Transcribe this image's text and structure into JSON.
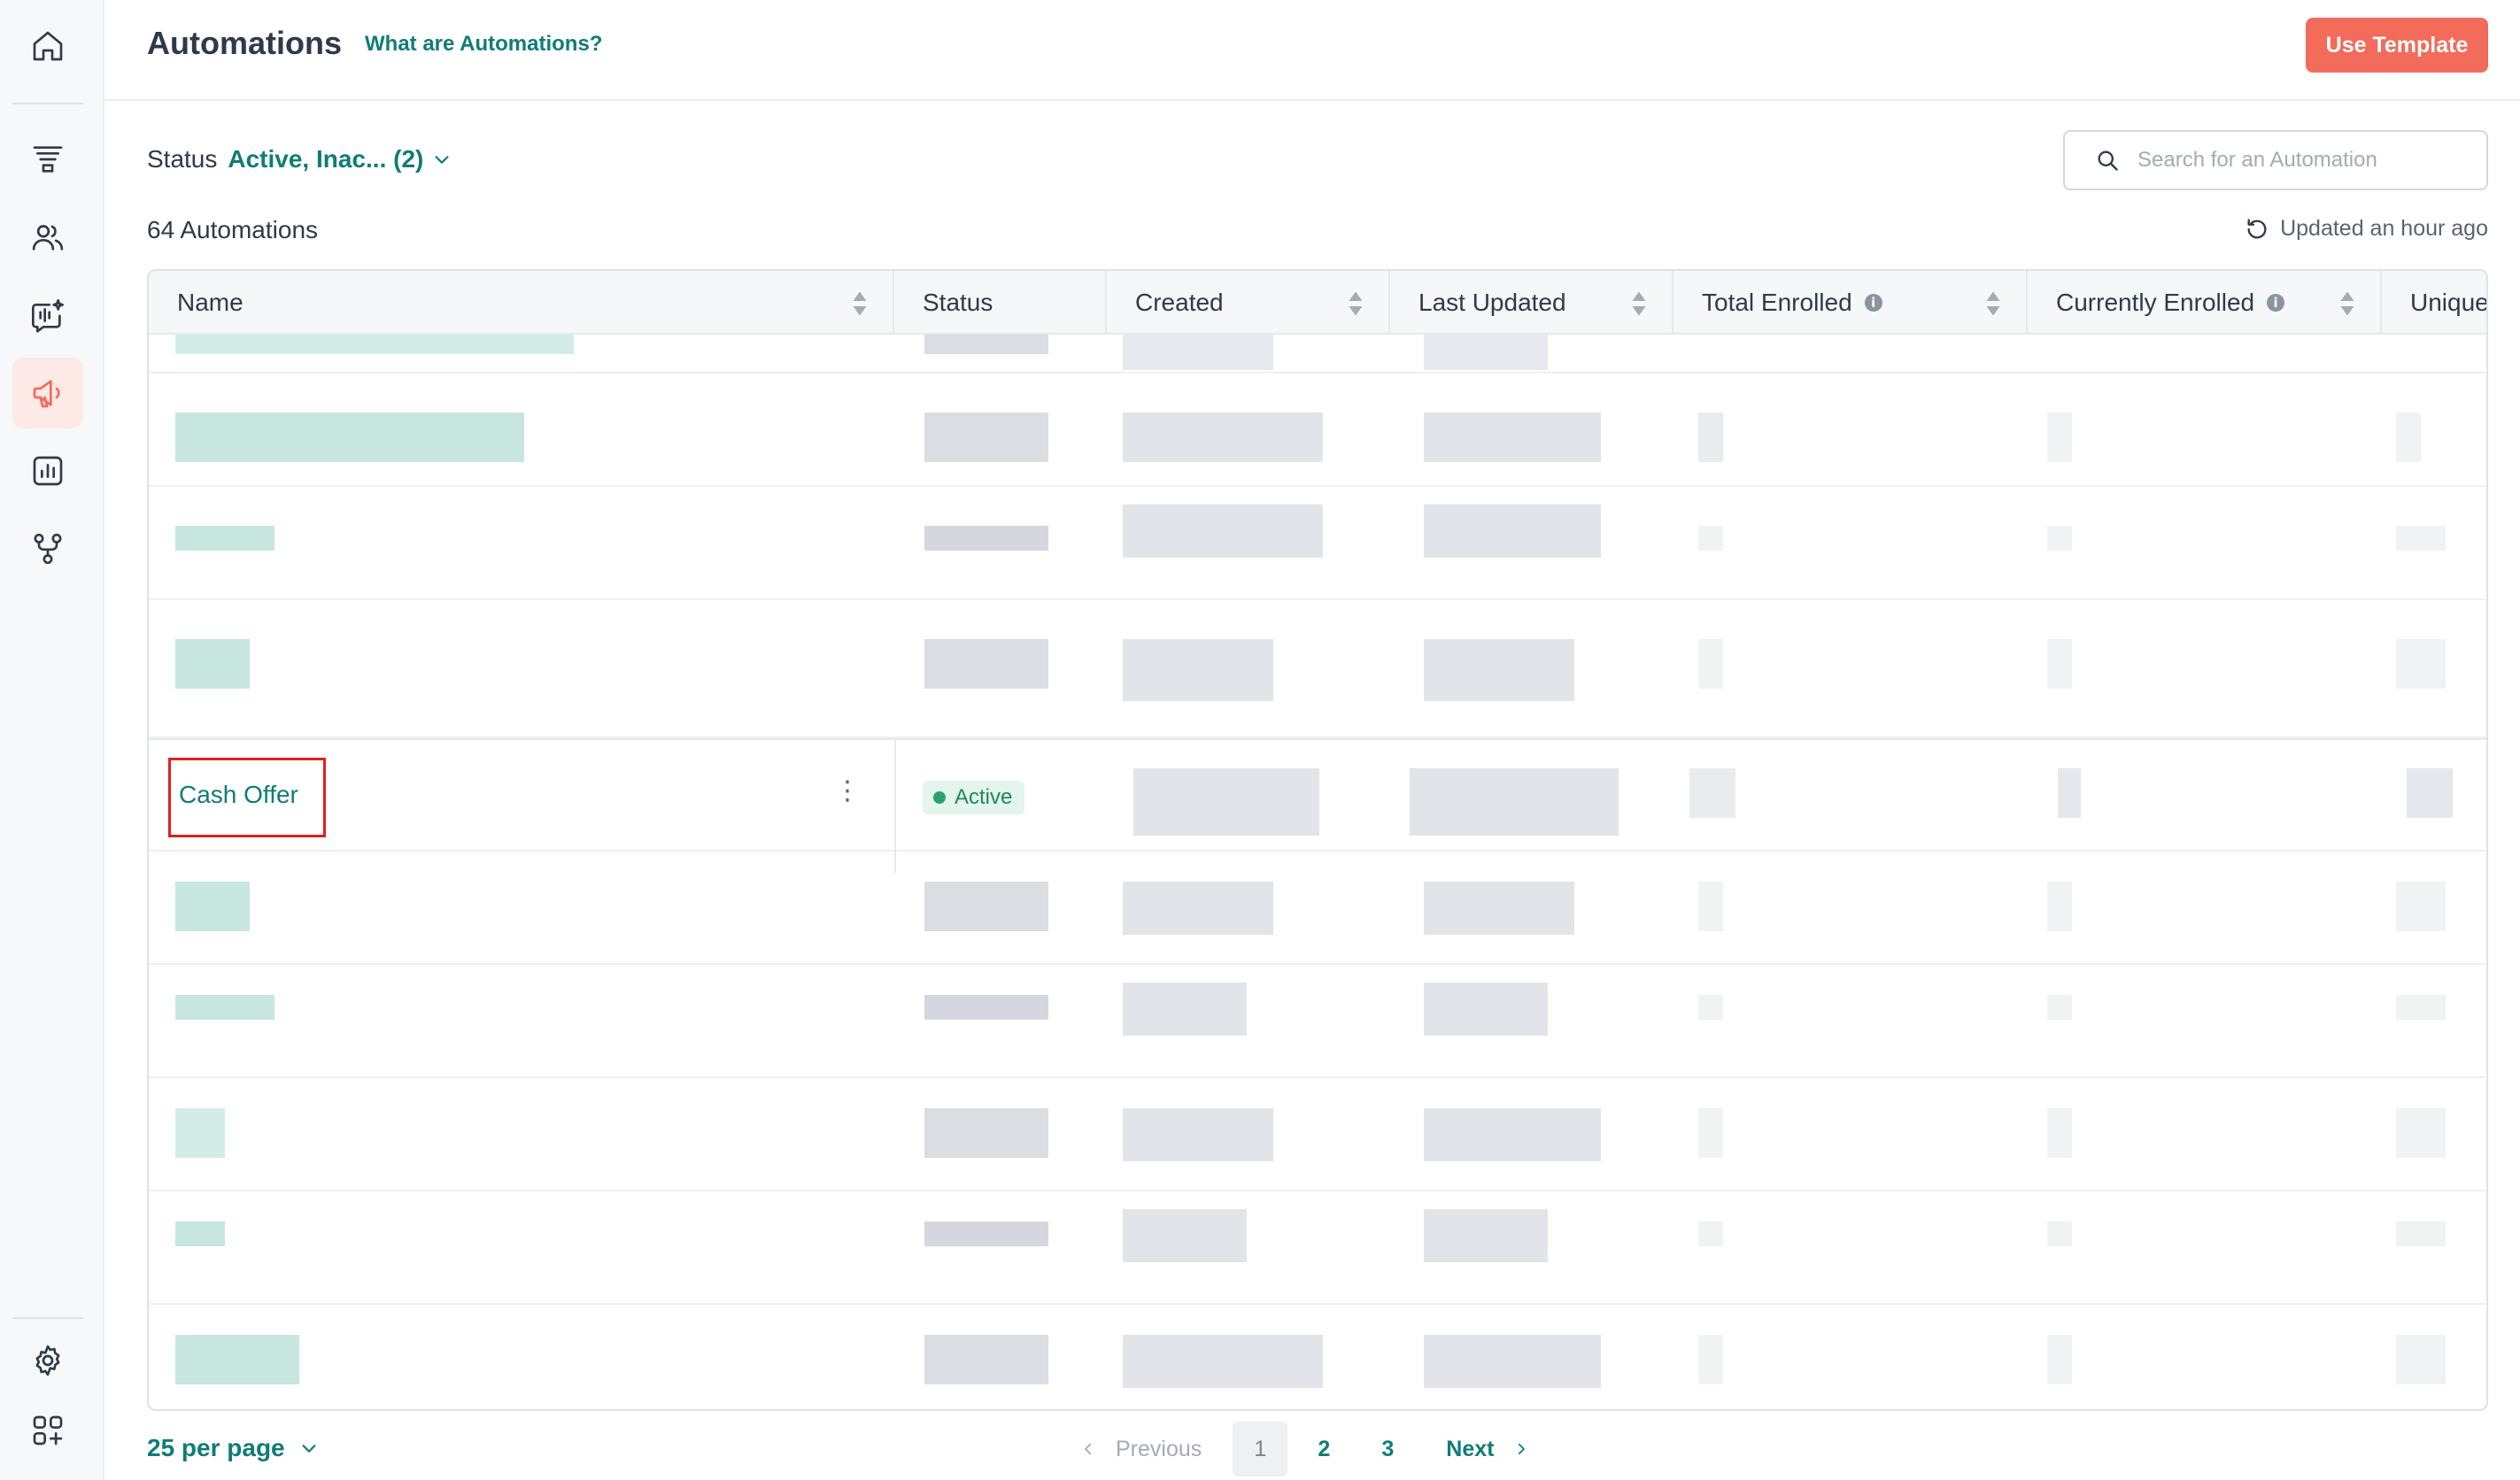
{
  "sidebar": {
    "items": [
      {
        "icon": "home-icon"
      },
      {
        "icon": "funnel-icon"
      },
      {
        "icon": "contacts-icon"
      },
      {
        "icon": "voice-chat-icon"
      },
      {
        "icon": "megaphone-icon",
        "active": true
      },
      {
        "icon": "reports-icon"
      },
      {
        "icon": "workflow-icon"
      },
      {
        "icon": "gear-icon"
      },
      {
        "icon": "apps-icon"
      }
    ],
    "active_color": "#f26b5b"
  },
  "header": {
    "title": "Automations",
    "help_link": "What are Automations?",
    "primary_button": "Use Template"
  },
  "filters": {
    "status_label": "Status",
    "status_value": "Active, Inac... (2)",
    "search_placeholder": "Search for an Automation"
  },
  "summary": {
    "count_text": "64 Automations",
    "updated_text": "Updated an hour ago"
  },
  "table": {
    "columns": [
      "Name",
      "Status",
      "Created",
      "Last Updated",
      "Total Enrolled",
      "Currently Enrolled",
      "Unique"
    ],
    "highlighted_row": {
      "name": "Cash Offer",
      "status": "Active"
    }
  },
  "footer": {
    "per_page": "25 per page",
    "previous": "Previous",
    "pages": [
      "1",
      "2",
      "3"
    ],
    "current_page": "1",
    "next": "Next"
  },
  "colors": {
    "brand_teal": "#107c78",
    "accent_coral": "#f26b5b",
    "status_active": "#2aa36b"
  }
}
